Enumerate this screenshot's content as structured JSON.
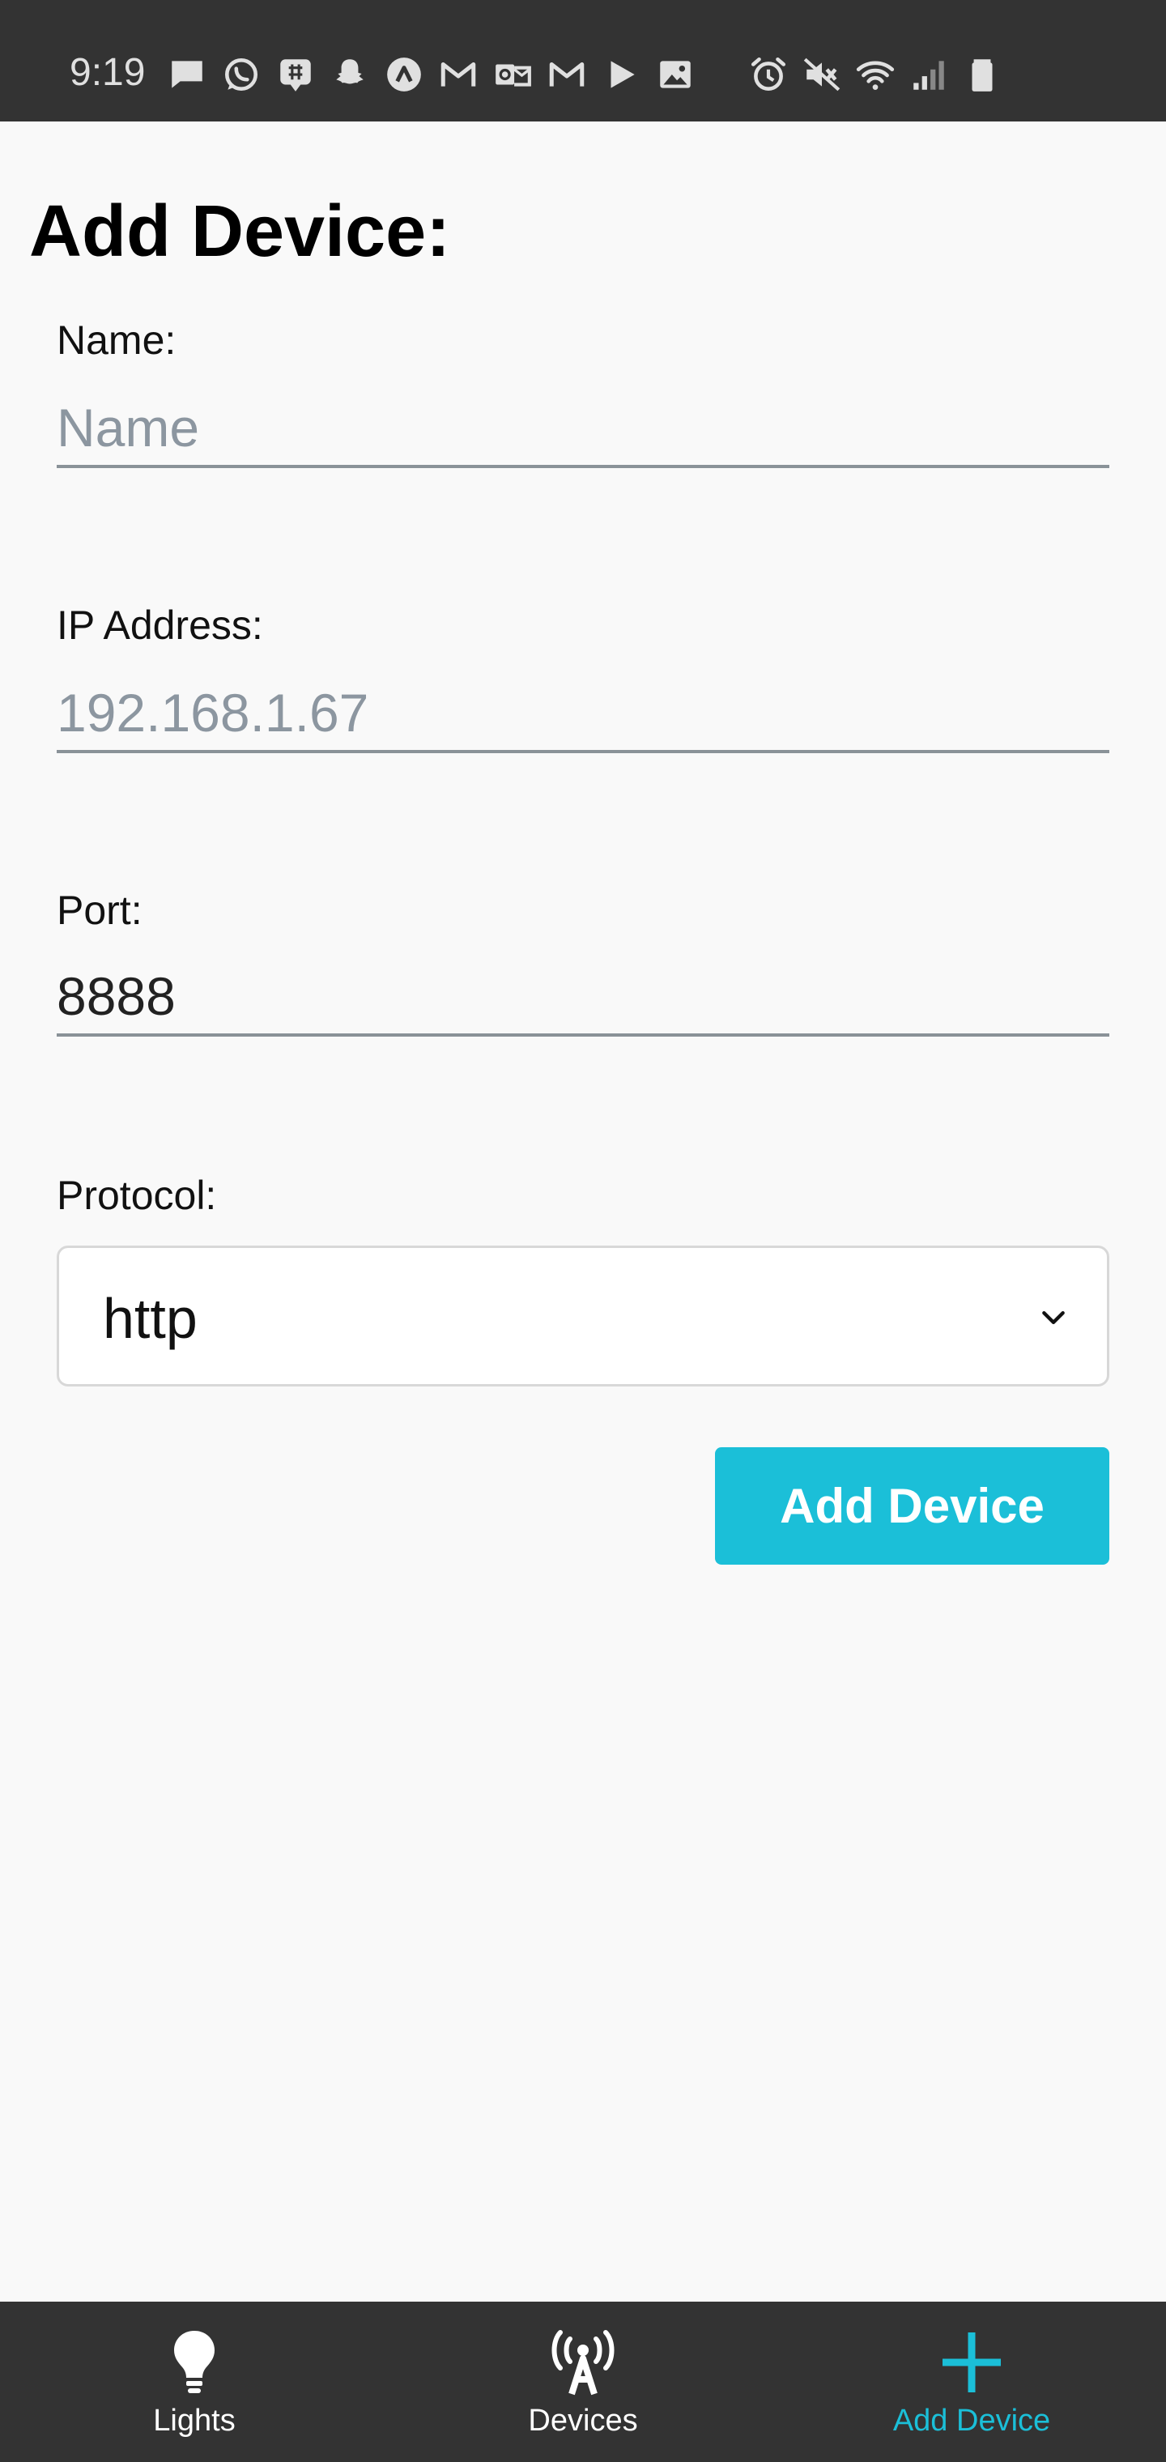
{
  "status_bar": {
    "time": "9:19",
    "notification_icons": [
      "message-icon",
      "whatsapp-icon",
      "chat-icon",
      "snapchat-icon",
      "app-icon",
      "gmail-icon",
      "outlook-icon",
      "gmail-icon",
      "play-icon",
      "gallery-icon"
    ],
    "system_icons": [
      "alarm-icon",
      "mute-icon",
      "wifi-icon",
      "signal-icon",
      "battery-icon"
    ]
  },
  "page": {
    "title": "Add Device:"
  },
  "form": {
    "name": {
      "label": "Name:",
      "placeholder": "Name",
      "value": ""
    },
    "ip": {
      "label": "IP Address:",
      "placeholder": "192.168.1.67",
      "value": ""
    },
    "port": {
      "label": "Port:",
      "value": "8888"
    },
    "protocol": {
      "label": "Protocol:",
      "selected": "http"
    },
    "submit_label": "Add Device"
  },
  "tabbar": {
    "lights": {
      "label": "Lights",
      "icon": "lightbulb-icon"
    },
    "devices": {
      "label": "Devices",
      "icon": "antenna-icon"
    },
    "add_device": {
      "label": "Add Device",
      "icon": "plus-icon",
      "active": true
    }
  },
  "colors": {
    "accent": "#1bbfd8",
    "bar": "#333333",
    "background": "#f9f9f9"
  }
}
